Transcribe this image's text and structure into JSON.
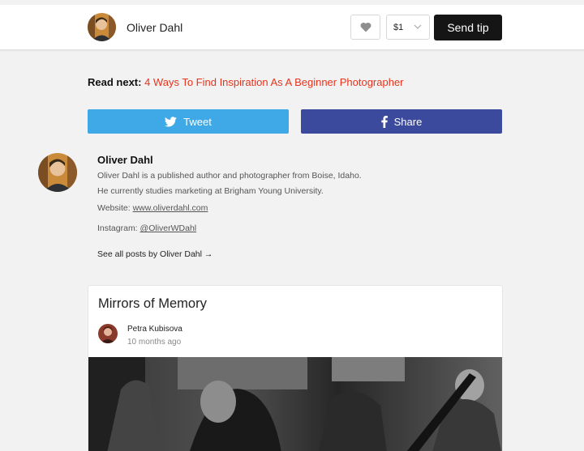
{
  "header": {
    "author_name": "Oliver Dahl",
    "tip_amount": "$1",
    "send_tip_label": "Send tip",
    "icons": {
      "like": "heart-icon",
      "dropdown": "chevron-down-icon"
    }
  },
  "read_next": {
    "label": "Read next:",
    "title": "4 Ways To Find Inspiration As A Beginner Photographer",
    "color": "#e8331c"
  },
  "share": {
    "tweet_label": "Tweet",
    "share_label": "Share",
    "tweet_color": "#3fa9e8",
    "share_color": "#3b4a9c",
    "icons": {
      "tweet": "twitter-icon",
      "share": "facebook-icon"
    }
  },
  "bio": {
    "name": "Oliver Dahl",
    "line1": "Oliver Dahl is a published author and photographer from Boise, Idaho.",
    "line2": "He currently studies marketing at Brigham Young University.",
    "website_label": "Website:",
    "website_url": "www.oliverdahl.com",
    "instagram_label": "Instagram:",
    "instagram_handle": "@OliverWDahl",
    "see_all": "See all posts by Oliver Dahl →"
  },
  "card": {
    "title": "Mirrors of Memory",
    "author": "Petra Kubisova",
    "time": "10 months ago"
  }
}
